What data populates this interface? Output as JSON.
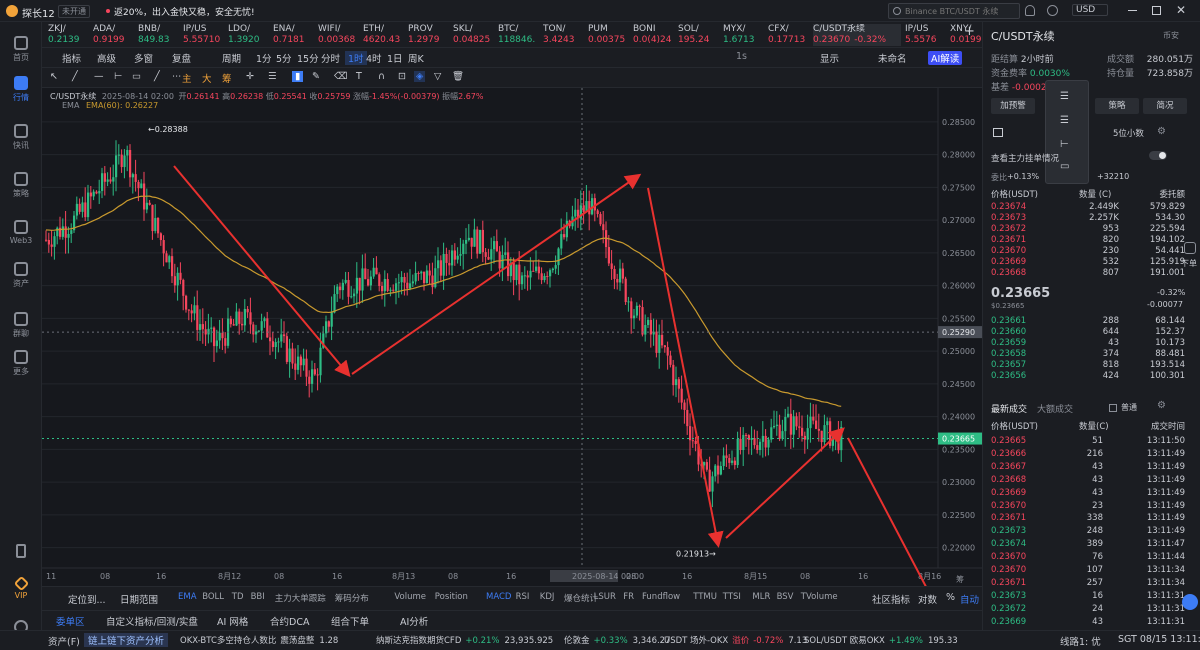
{
  "titlebar": {
    "app_name": "探长12",
    "badge": "未开通",
    "promo": "返20%，出入金快又稳，安全无忧!",
    "search_placeholder": "Binance BTC/USDT 永续",
    "currency": "USD"
  },
  "sidebar": [
    {
      "label": "首页"
    },
    {
      "label": "行情"
    },
    {
      "label": "快讯"
    },
    {
      "label": "策略"
    },
    {
      "label": "Web3"
    },
    {
      "label": "资产"
    },
    {
      "label": "群聊"
    },
    {
      "label": "更多"
    },
    {
      "label": "VIP"
    }
  ],
  "tickers": [
    {
      "name": "ZKJ/",
      "price": "0.2139",
      "dir": "up"
    },
    {
      "name": "ADA/",
      "price": "0.9199",
      "dir": "dn"
    },
    {
      "name": "BNB/",
      "price": "849.83",
      "dir": "up"
    },
    {
      "name": "IP/US",
      "price": "5.55710",
      "dir": "dn"
    },
    {
      "name": "LDO/",
      "price": "1.3920",
      "dir": "up"
    },
    {
      "name": "ENA/",
      "price": "0.7181",
      "dir": "dn"
    },
    {
      "name": "WIFI/",
      "price": "0.00368",
      "dir": "dn"
    },
    {
      "name": "ETH/",
      "price": "4620.43",
      "dir": "dn"
    },
    {
      "name": "PROV",
      "price": "1.2979",
      "dir": "dn"
    },
    {
      "name": "SKL/",
      "price": "0.04825",
      "dir": "dn"
    },
    {
      "name": "BTC/",
      "price": "118846.",
      "dir": "up"
    },
    {
      "name": "TON/",
      "price": "3.4243",
      "dir": "dn"
    },
    {
      "name": "PUM",
      "price": "0.00375",
      "dir": "dn"
    },
    {
      "name": "BONI",
      "price": "0.0(4)24",
      "dir": "dn"
    },
    {
      "name": "SOL/",
      "price": "195.24",
      "dir": "dn"
    },
    {
      "name": "MYX/",
      "price": "1.6713",
      "dir": "up"
    },
    {
      "name": "CFX/",
      "price": "0.17713",
      "dir": "dn"
    },
    {
      "name": "C/USDT永续",
      "price": "0.23670",
      "change": "-0.32%",
      "dir": "dn",
      "active": true
    },
    {
      "name": "IP/US",
      "price": "5.5576",
      "dir": "dn"
    },
    {
      "name": "XNY/",
      "price": "0.01991",
      "dir": "dn"
    }
  ],
  "toolbar": {
    "indicator": "指标",
    "advanced": "高级",
    "multi": "多窗",
    "replay": "复盘",
    "period": "周期",
    "intervals": [
      "1分",
      "5分",
      "15分",
      "分时",
      "1时",
      "4时",
      "1日",
      "周K"
    ],
    "selected_interval": "1时",
    "tools_text": [
      "主",
      "大",
      "筹"
    ],
    "show": "显示",
    "unnamed": "未命名",
    "ai_button": "AI解读",
    "scale_label": "1s"
  },
  "chart": {
    "symbol": "C/USDT永续",
    "datetime": "2025-08-14 02:00",
    "ohlc": {
      "open_label": "开",
      "open": "0.26141",
      "high_label": "高",
      "high": "0.26238",
      "low_label": "低",
      "low": "0.25541",
      "close_label": "收",
      "close": "0.25759",
      "change_label": "涨幅",
      "change": "-1.45%(-0.00379)",
      "amp_label": "振幅",
      "amp": "2.67%"
    },
    "ema_label": "EMA",
    "ema_value": "EMA(60): 0.26227",
    "high_marker": "0.28388",
    "low_marker": "0.21913",
    "crosshair_price": "0.25290",
    "last_price": "0.23665",
    "price_ticks": [
      "0.28500",
      "0.28000",
      "0.27500",
      "0.27000",
      "0.26500",
      "0.26000",
      "0.25500",
      "0.25000",
      "0.24500",
      "0.24000",
      "0.23500",
      "0.23000",
      "0.22500",
      "0.22000"
    ],
    "time_ticks": [
      "11",
      "08",
      "16",
      "8月12",
      "08",
      "16",
      "8月13",
      "08",
      "16",
      "2025-08-14 02:00",
      "08",
      "16",
      "8月15",
      "08",
      "16",
      "8月16"
    ],
    "corner_label": "筹"
  },
  "indicator_bar": {
    "locate": "定位到...",
    "date_range": "日期范围",
    "items": [
      "EMA",
      "BOLL",
      "TD",
      "BBI",
      "主力大单跟踪",
      "筹码分布",
      "Volume",
      "Position",
      "MACD",
      "RSI",
      "KDJ",
      "爆仓统计",
      "LSUR",
      "FR",
      "Fundflow",
      "TTMU",
      "TTSI",
      "MLR",
      "BSV",
      "TVolume"
    ],
    "community": "社区指标",
    "log": "对数",
    "pct": "%",
    "auto": "自动"
  },
  "pane_tabs": [
    "委单区",
    "自定义指标/回测/实盘",
    "AI 网格",
    "合约DCA",
    "组合下单",
    "AI分析"
  ],
  "status": {
    "assets": "资产(F)",
    "onchain": "链上链下资产分析",
    "items": [
      {
        "label": "OKX-BTC多空持仓人数比",
        "extra": "震荡盘整",
        "value": "1.28"
      },
      {
        "label": "纳斯达克指数期货CFD",
        "change": "+0.21%",
        "value": "23,935.925",
        "dir": "up"
      },
      {
        "label": "伦敦金",
        "change": "+0.33%",
        "value": "3,346.27",
        "dir": "up"
      },
      {
        "label": "USDT 场外-OKX",
        "extra": "溢价",
        "change": "-0.72%",
        "value": "7.13",
        "dir": "dn"
      },
      {
        "label": "SOL/USDT 欧易OKX",
        "change": "+1.49%",
        "value": "195.33",
        "dir": "up"
      }
    ],
    "route": "线路1: 优",
    "time": "SGT 08/15 13:11:53"
  },
  "rightpanel": {
    "title": "C/USDT永续",
    "platform": "币安",
    "settle_label": "距结算",
    "settle_value": "2小时前",
    "volume_label": "成交额",
    "volume_value": "280.051万",
    "fund_label": "资金费率",
    "fund_value": "0.0030%",
    "oi_label": "持仓量",
    "oi_value": "723.858万",
    "basis_label": "基差",
    "basis_value": "-0.00020",
    "buttons": [
      "加预警",
      "策略",
      "简况"
    ],
    "decimals": "5位小数",
    "mainorder_label": "查看主力挂单情况",
    "ratio_left": "+0.13%",
    "ratio_right": "+32210",
    "ratio_label": "委比",
    "ob_headers": [
      "价格(USDT)",
      "数量 (C)",
      "委托额"
    ],
    "asks": [
      [
        "0.23674",
        "2.449K",
        "579.829"
      ],
      [
        "0.23673",
        "2.257K",
        "534.30"
      ],
      [
        "0.23672",
        "953",
        "225.594"
      ],
      [
        "0.23671",
        "820",
        "194.102"
      ],
      [
        "0.23670",
        "230",
        "54.441"
      ],
      [
        "0.23669",
        "532",
        "125.919"
      ],
      [
        "0.23668",
        "807",
        "191.001"
      ]
    ],
    "mid_price": "0.23665",
    "mid_sub": "$0.23665",
    "mid_change": "-0.32%",
    "mid_change_abs": "-0.00077",
    "bids": [
      [
        "0.23661",
        "288",
        "68.144"
      ],
      [
        "0.23660",
        "644",
        "152.37"
      ],
      [
        "0.23659",
        "43",
        "10.173"
      ],
      [
        "0.23658",
        "374",
        "88.481"
      ],
      [
        "0.23657",
        "818",
        "193.514"
      ],
      [
        "0.23656",
        "424",
        "100.301"
      ]
    ],
    "trades_tab": "最新成交",
    "big_tab": "大额成交",
    "normal": "普通",
    "trade_headers": [
      "价格(USDT)",
      "数量(C)",
      "成交时间"
    ],
    "trades": [
      [
        "0.23665",
        "51",
        "13:11:50",
        "dn"
      ],
      [
        "0.23666",
        "216",
        "13:11:49",
        "dn"
      ],
      [
        "0.23667",
        "43",
        "13:11:49",
        "dn"
      ],
      [
        "0.23668",
        "43",
        "13:11:49",
        "dn"
      ],
      [
        "0.23669",
        "43",
        "13:11:49",
        "dn"
      ],
      [
        "0.23670",
        "23",
        "13:11:49",
        "dn"
      ],
      [
        "0.23671",
        "338",
        "13:11:49",
        "dn"
      ],
      [
        "0.23673",
        "248",
        "13:11:49",
        "up"
      ],
      [
        "0.23674",
        "389",
        "13:11:47",
        "up"
      ],
      [
        "0.23670",
        "76",
        "13:11:44",
        "dn"
      ],
      [
        "0.23670",
        "107",
        "13:11:34",
        "dn"
      ],
      [
        "0.23671",
        "257",
        "13:11:34",
        "dn"
      ],
      [
        "0.23673",
        "16",
        "13:11:31",
        "up"
      ],
      [
        "0.23672",
        "24",
        "13:11:31",
        "up"
      ],
      [
        "0.23669",
        "43",
        "13:11:31",
        "up"
      ]
    ],
    "side_label": "下单"
  },
  "colors": {
    "up": "#2ebd85",
    "down": "#f6465d",
    "accent": "#3d7cf5",
    "ema": "#c99a2e",
    "arrow": "#e8312f"
  }
}
